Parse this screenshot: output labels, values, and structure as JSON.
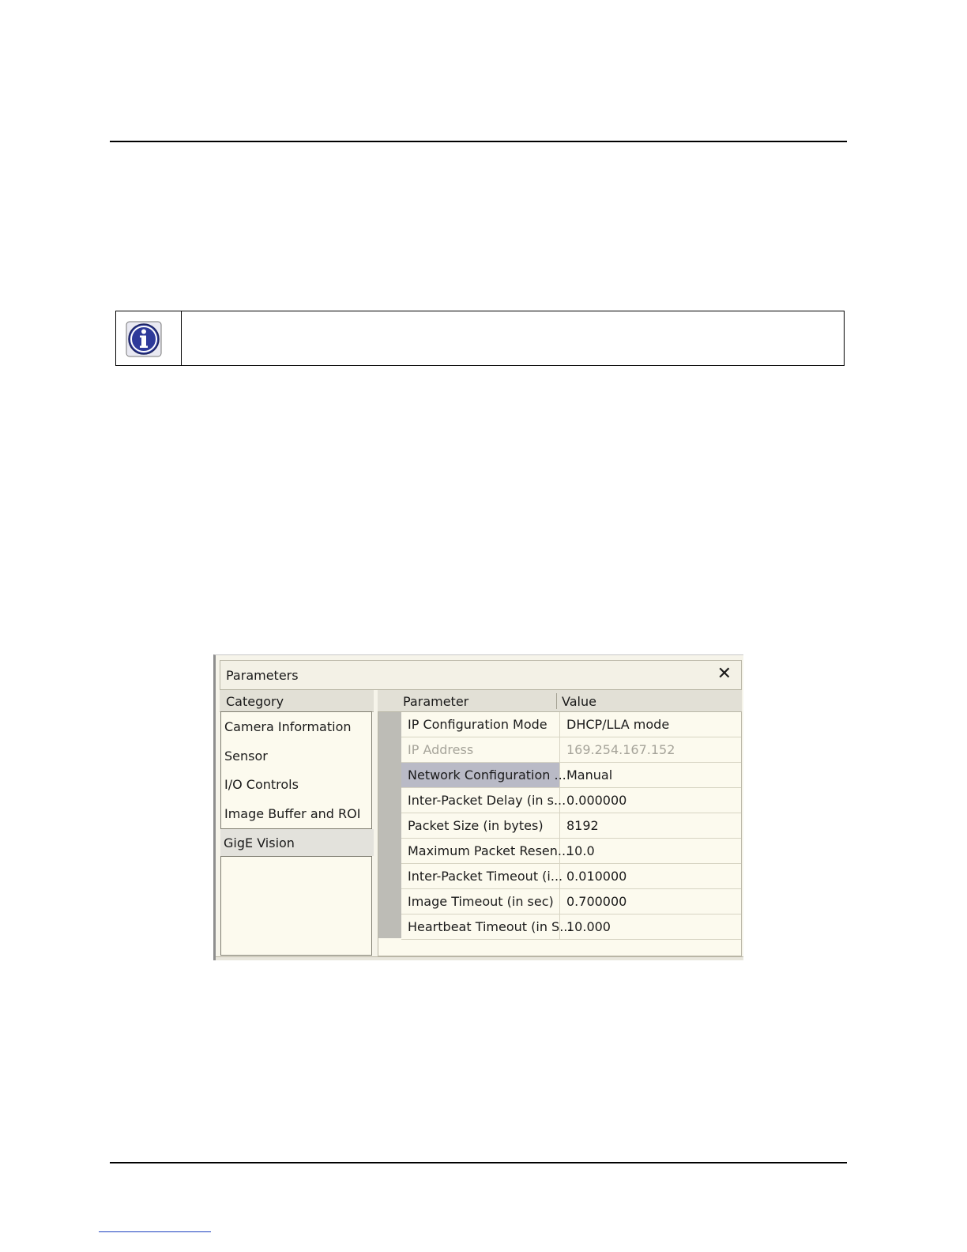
{
  "panel": {
    "title": "Parameters",
    "close_glyph": "✕",
    "category_header": "Category",
    "parameter_header": "Parameter",
    "value_header": "Value",
    "categories": [
      {
        "label": "Camera Information"
      },
      {
        "label": "Sensor"
      },
      {
        "label": "I/O Controls"
      },
      {
        "label": "Image Buffer and ROI"
      },
      {
        "label": "GigE Vision"
      }
    ],
    "selected_category": "GigE Vision",
    "rows": [
      {
        "param": "IP Configuration Mode",
        "value": "DHCP/LLA mode",
        "state": "normal"
      },
      {
        "param": "IP Address",
        "value": "169.254.167.152",
        "state": "disabled"
      },
      {
        "param": "Network Configuration ...",
        "value": "Manual",
        "state": "highlight"
      },
      {
        "param": "Inter-Packet Delay (in s...",
        "value": "0.000000",
        "state": "normal"
      },
      {
        "param": "Packet Size (in bytes)",
        "value": "8192",
        "state": "normal"
      },
      {
        "param": "Maximum Packet Resen...",
        "value": "10.0",
        "state": "normal"
      },
      {
        "param": "Inter-Packet Timeout (i...",
        "value": "0.010000",
        "state": "normal"
      },
      {
        "param": "Image Timeout (in sec)",
        "value": "0.700000",
        "state": "normal"
      },
      {
        "param": "Heartbeat Timeout (in S...",
        "value": "10.000",
        "state": "normal"
      }
    ]
  },
  "colors": {
    "info_icon_fill": "#2e3a9a",
    "highlight_row": "#b9bac6",
    "disabled_text": "#a6a49a"
  },
  "icons": {
    "info": "info-icon",
    "close": "close-icon"
  }
}
